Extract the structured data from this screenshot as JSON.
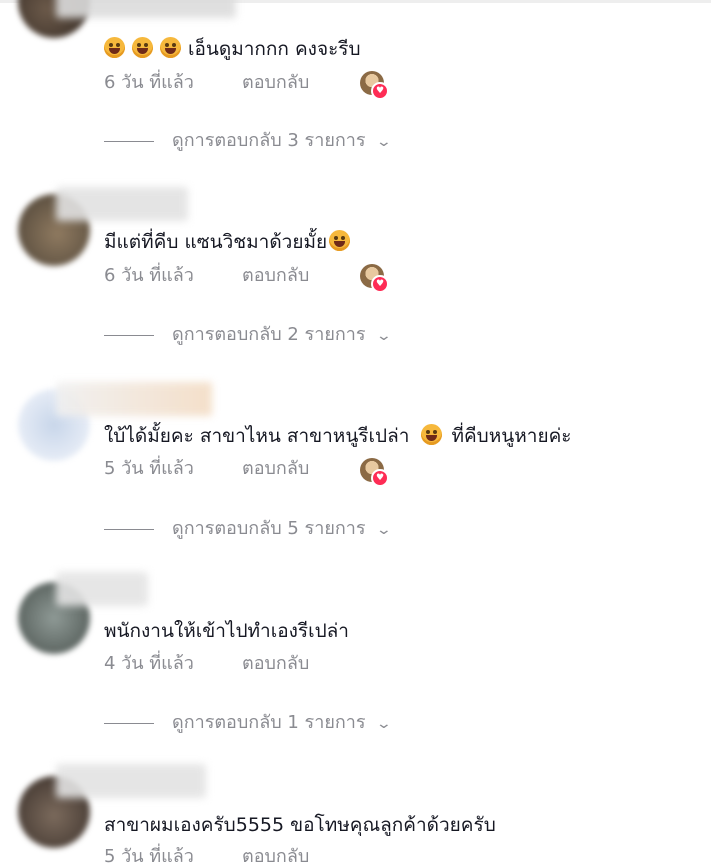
{
  "comments": [
    {
      "text": "เอ็นดูมากกก คงจะรีบ",
      "emojis_before": 3,
      "time": "6 วัน ที่แล้ว",
      "reply_label": "ตอบกลับ",
      "view_replies": "ดูการตอบกลับ 3 รายการ"
    },
    {
      "text": "มีแต่ที่คีบ แซนวิชมาด้วยมั้ย",
      "time": "6 วัน ที่แล้ว",
      "reply_label": "ตอบกลับ",
      "view_replies": "ดูการตอบกลับ 2 รายการ"
    },
    {
      "text_a": "ใบ้ได้มั้ยคะ สาขาไหน สาขาหนูรีเปล่า",
      "text_b": "ที่คีบหนูหายค่ะ",
      "time": "5 วัน ที่แล้ว",
      "reply_label": "ตอบกลับ",
      "view_replies": "ดูการตอบกลับ 5 รายการ"
    },
    {
      "text": "พนักงานให้เข้าไปทำเองรีเปล่า",
      "time": "4 วัน ที่แล้ว",
      "reply_label": "ตอบกลับ",
      "view_replies": "ดูการตอบกลับ 1 รายการ"
    },
    {
      "text": "สาขาผมเองครับ5555 ขอโทษคุณลูกค้าด้วยครับ",
      "time": "5 วัน ที่แล้ว",
      "reply_label": "ตอบกลับ"
    }
  ],
  "icons": {
    "emoji": "laughing-face-icon",
    "chevron": "chevron-down-icon",
    "liked": "heart-icon"
  },
  "colors": {
    "text": "#161823",
    "muted": "#8a8b91",
    "heart": "#fe2c55"
  }
}
